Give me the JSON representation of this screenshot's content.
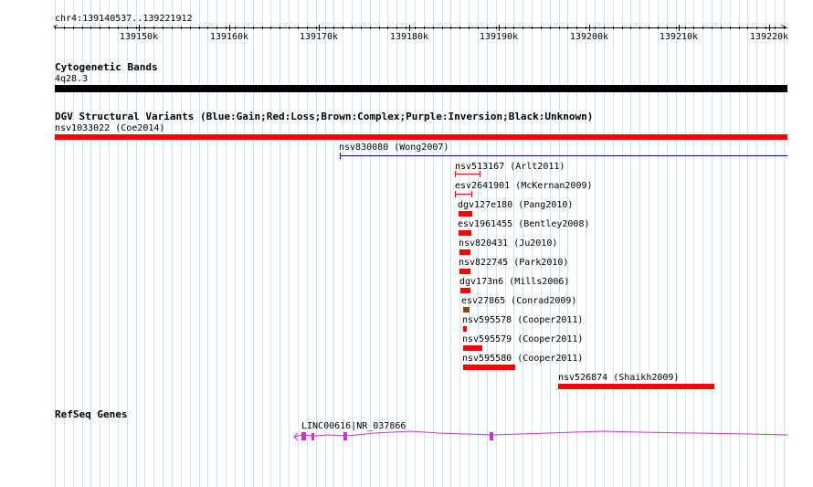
{
  "colors": {
    "grid": "#c9e6f3",
    "loss": "#ff0000",
    "gain": "#0000cc",
    "complex": "#8b4513",
    "gene": "#cc33cc",
    "black": "#000000"
  },
  "ruler": {
    "position_label": "chr4:139140537..139221912",
    "tick_labels": [
      "139150k",
      "139160k",
      "139170k",
      "139180k",
      "139190k",
      "139200k",
      "139210k",
      "139220k"
    ]
  },
  "cytoband": {
    "title": "Cytogenetic Bands",
    "band_label": "4q28.3"
  },
  "dgv": {
    "title": "DGV Structural Variants (Blue:Gain;Red:Loss;Brown:Complex;Purple:Inversion;Black:Unknown)",
    "features": [
      {
        "label": "nsv1033022 (Coe2014)",
        "color": "loss",
        "style": "bar"
      },
      {
        "label": "nsv830080 (Wong2007)",
        "color": "gain",
        "style": "line"
      },
      {
        "label": "nsv513167 (Arlt2011)",
        "color": "loss",
        "style": "range"
      },
      {
        "label": "esv2641901 (McKernan2009)",
        "color": "loss",
        "style": "range"
      },
      {
        "label": "dgv127e180 (Pang2010)",
        "color": "loss",
        "style": "bar"
      },
      {
        "label": "esv1961455 (Bentley2008)",
        "color": "loss",
        "style": "bar"
      },
      {
        "label": "nsv820431 (Ju2010)",
        "color": "loss",
        "style": "bar"
      },
      {
        "label": "nsv822745 (Park2010)",
        "color": "loss",
        "style": "bar"
      },
      {
        "label": "dgv173n6 (Mills2006)",
        "color": "loss",
        "style": "bar"
      },
      {
        "label": "esv27865 (Conrad2009)",
        "color": "complex",
        "style": "bar"
      },
      {
        "label": "nsv595578 (Cooper2011)",
        "color": "loss",
        "style": "bar"
      },
      {
        "label": "nsv595579 (Cooper2011)",
        "color": "loss",
        "style": "bar"
      },
      {
        "label": "nsv595580 (Cooper2011)",
        "color": "loss",
        "style": "bar"
      },
      {
        "label": "nsv526874 (Shaikh2009)",
        "color": "loss",
        "style": "bar"
      }
    ]
  },
  "refseq": {
    "title": "RefSeq Genes",
    "gene_label": "LINC00616|NR_037866"
  }
}
